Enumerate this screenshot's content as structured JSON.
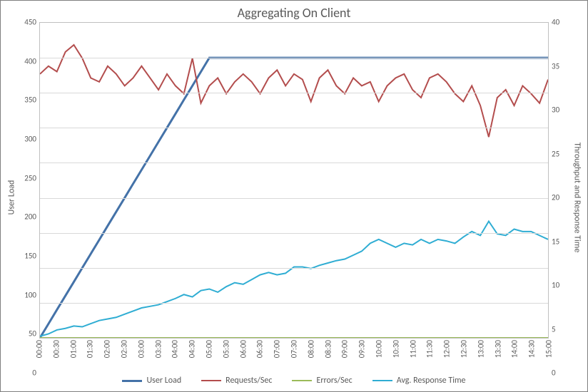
{
  "chart_data": {
    "type": "line",
    "title": "Aggregating On Client",
    "xlabel": "",
    "ylabel_left": "User Load",
    "ylabel_right": "Throughput and Response Time",
    "ylim_left": [
      0,
      450
    ],
    "ylim_right": [
      0,
      40
    ],
    "yticks_left": [
      0,
      50,
      100,
      150,
      200,
      250,
      300,
      350,
      400,
      450
    ],
    "yticks_right": [
      0,
      5,
      10,
      15,
      20,
      25,
      30,
      35,
      40
    ],
    "categories": [
      "00:00",
      "00:30",
      "01:00",
      "01:30",
      "02:00",
      "02:30",
      "03:00",
      "03:30",
      "04:00",
      "04:30",
      "05:00",
      "05:30",
      "06:00",
      "06:30",
      "07:00",
      "07:30",
      "08:00",
      "08:30",
      "09:00",
      "09:30",
      "10:00",
      "10:30",
      "11:00",
      "11:30",
      "12:00",
      "12:30",
      "13:00",
      "13:30",
      "14:00",
      "14:30",
      "15:00"
    ],
    "x_interval_minutes": 0.25,
    "x_count": 61,
    "series": [
      {
        "name": "User Load",
        "axis": "left",
        "color": "#4472a8",
        "width": 3,
        "values": [
          0,
          20,
          40,
          60,
          80,
          100,
          120,
          140,
          160,
          180,
          200,
          220,
          240,
          260,
          280,
          300,
          320,
          340,
          360,
          380,
          400,
          400,
          400,
          400,
          400,
          400,
          400,
          400,
          400,
          400,
          400,
          400,
          400,
          400,
          400,
          400,
          400,
          400,
          400,
          400,
          400,
          400,
          400,
          400,
          400,
          400,
          400,
          400,
          400,
          400,
          400,
          400,
          400,
          400,
          400,
          400,
          400,
          400,
          400,
          400,
          400
        ]
      },
      {
        "name": "Requests/Sec",
        "axis": "right",
        "color": "#b34d4d",
        "width": 2,
        "values": [
          33.5,
          34.5,
          33.8,
          36.3,
          37.2,
          35.5,
          33.0,
          32.5,
          34.5,
          33.5,
          32.0,
          33.0,
          34.5,
          33.0,
          31.5,
          33.5,
          32.0,
          31.0,
          35.5,
          29.8,
          32.0,
          33.0,
          31.0,
          32.5,
          33.5,
          32.5,
          31.0,
          33.0,
          34.0,
          32.0,
          33.5,
          32.8,
          30.0,
          33.0,
          34.0,
          32.0,
          31.0,
          33.0,
          32.0,
          32.5,
          30.0,
          32.0,
          33.0,
          33.5,
          31.5,
          30.5,
          33.0,
          33.5,
          32.5,
          31.0,
          30.0,
          32.0,
          29.5,
          25.5,
          30.5,
          31.5,
          29.5,
          32.0,
          31.0,
          29.8,
          32.8
        ]
      },
      {
        "name": "Errors/Sec",
        "axis": "right",
        "color": "#9bbb59",
        "width": 2,
        "values": [
          0,
          0,
          0,
          0,
          0,
          0,
          0,
          0,
          0,
          0,
          0,
          0,
          0,
          0,
          0,
          0,
          0,
          0,
          0,
          0,
          0,
          0,
          0,
          0,
          0,
          0,
          0,
          0,
          0,
          0,
          0,
          0,
          0,
          0,
          0,
          0,
          0,
          0,
          0,
          0,
          0,
          0,
          0,
          0,
          0,
          0,
          0,
          0,
          0,
          0,
          0,
          0,
          0,
          0,
          0,
          0,
          0,
          0,
          0,
          0,
          0
        ]
      },
      {
        "name": "Avg. Response Time",
        "axis": "right",
        "color": "#2fadd3",
        "width": 2,
        "values": [
          0.2,
          0.5,
          1.0,
          1.2,
          1.5,
          1.4,
          1.8,
          2.2,
          2.4,
          2.6,
          3.0,
          3.4,
          3.8,
          4.0,
          4.2,
          4.6,
          5.0,
          5.5,
          5.2,
          6.0,
          6.2,
          5.8,
          6.5,
          7.0,
          6.8,
          7.4,
          8.0,
          8.3,
          8.0,
          8.2,
          9.0,
          9.0,
          8.8,
          9.2,
          9.5,
          9.8,
          10.0,
          10.5,
          11.0,
          12.0,
          12.5,
          12.0,
          11.5,
          12.0,
          11.8,
          12.5,
          12.0,
          12.5,
          12.3,
          12.0,
          12.8,
          13.5,
          13.0,
          14.8,
          13.2,
          13.0,
          13.8,
          13.5,
          13.5,
          13.0,
          12.5
        ]
      }
    ],
    "legend": [
      "User Load",
      "Requests/Sec",
      "Errors/Sec",
      "Avg. Response Time"
    ],
    "legend_position": "bottom",
    "grid": true
  },
  "colors": {
    "user_load": "#4472a8",
    "requests": "#b34d4d",
    "errors": "#9bbb59",
    "response": "#2fadd3"
  }
}
